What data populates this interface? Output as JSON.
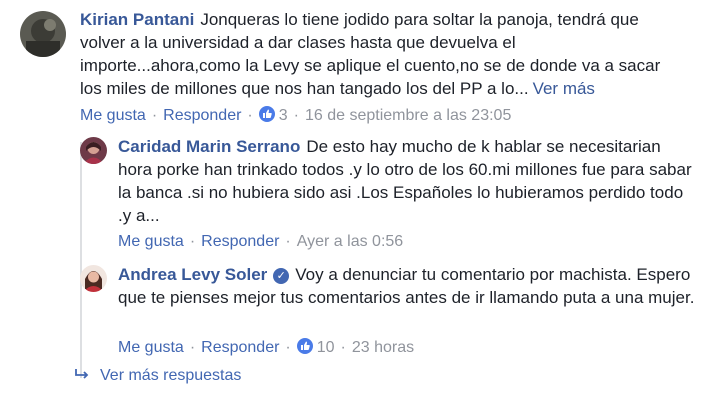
{
  "comments": [
    {
      "author": "Kirian Pantani",
      "text": "Jonqueras lo tiene jodido para soltar la panoja, tendrá que volver a la universidad a dar clases hasta que devuelva el importe...ahora,como la Levy se aplique el cuento,no se de donde va a sacar los miles de millones que nos han tangado los del PP a lo...",
      "see_more": "Ver más",
      "like": "Me gusta",
      "reply": "Responder",
      "reactions": "3",
      "time": "16 de septiembre a las 23:05"
    },
    {
      "author": "Caridad Marin Serrano",
      "text": "De esto hay mucho de k hablar se necesitarian hora porke han trinkado todos .y lo otro de los 60.mi millones fue para sabar la banca .si no hubiera sido asi .Los Españoles lo hubieramos perdido todo .y a...",
      "like": "Me gusta",
      "reply": "Responder",
      "time": "Ayer a las 0:56"
    },
    {
      "author": "Andrea Levy Soler",
      "verified": true,
      "text": "Voy a denunciar tu comentario por machista. Espero que te pienses mejor tus comentarios antes de ir llamando puta a una mujer.",
      "like": "Me gusta",
      "reply": "Responder",
      "reactions": "10",
      "time": "23 horas"
    }
  ],
  "more_replies": "Ver más respuestas",
  "icons": {
    "verified": "verified-check-icon",
    "like": "thumbs-up-icon",
    "reply_arrow": "reply-arrow-icon"
  },
  "colors": {
    "link": "#385898",
    "meta": "#90949c",
    "like_badge": "#4a7be8"
  }
}
